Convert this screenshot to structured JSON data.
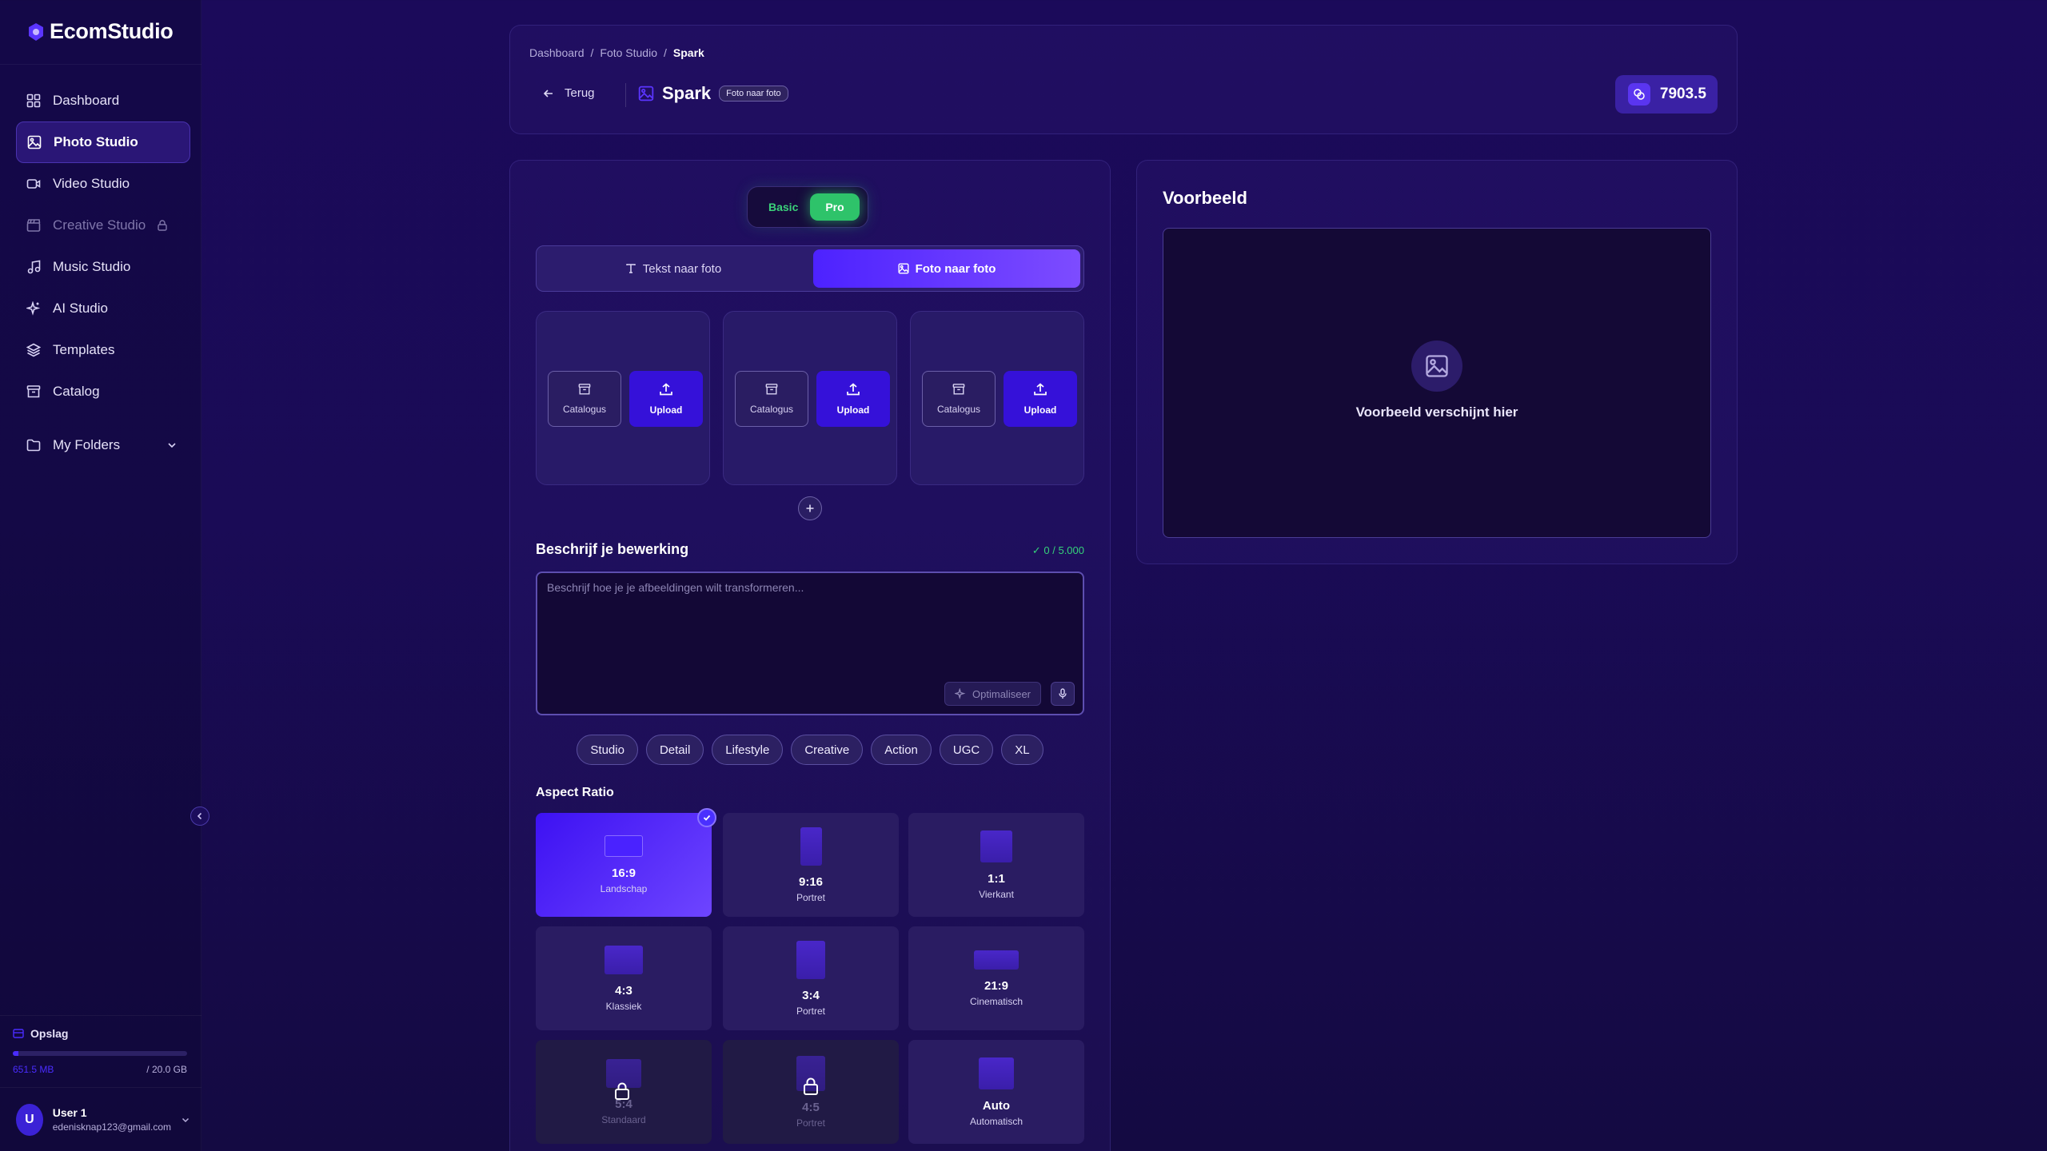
{
  "app": {
    "name": "EcomStudio"
  },
  "sidebar": {
    "items": [
      {
        "label": "Dashboard",
        "icon": "grid-icon"
      },
      {
        "label": "Photo Studio",
        "icon": "image-icon",
        "active": true
      },
      {
        "label": "Video Studio",
        "icon": "video-icon"
      },
      {
        "label": "Creative Studio",
        "icon": "clapperboard-icon",
        "locked": true
      },
      {
        "label": "Music Studio",
        "icon": "music-icon"
      },
      {
        "label": "AI Studio",
        "icon": "sparkles-icon"
      },
      {
        "label": "Templates",
        "icon": "layers-icon"
      },
      {
        "label": "Catalog",
        "icon": "archive-icon"
      }
    ],
    "folders_label": "My Folders",
    "storage": {
      "title": "Opslag",
      "used": "651.5 MB",
      "total": "/ 20.0 GB",
      "fraction": 0.032
    },
    "user": {
      "initial": "U",
      "name": "User 1",
      "email": "edenisknap123@gmail.com"
    }
  },
  "header": {
    "breadcrumb": [
      "Dashboard",
      "Foto Studio",
      "Spark"
    ],
    "back_label": "Terug",
    "title": "Spark",
    "badge": "Foto naar foto",
    "credits": "7903.5"
  },
  "editor": {
    "toggle": {
      "basic": "Basic",
      "pro": "Pro"
    },
    "modes": [
      "Tekst naar foto",
      "Foto naar foto"
    ],
    "slots": [
      {
        "catalog": "Catalogus",
        "upload": "Upload"
      },
      {
        "catalog": "Catalogus",
        "upload": "Upload"
      },
      {
        "catalog": "Catalogus",
        "upload": "Upload"
      }
    ],
    "describe_title": "Beschrijf je bewerking",
    "char_count": "✓ 0 / 5.000",
    "prompt_placeholder": "Beschrijf hoe je je afbeeldingen wilt transformeren...",
    "optimize_label": "Optimaliseer",
    "chips": [
      "Studio",
      "Detail",
      "Lifestyle",
      "Creative",
      "Action",
      "UGC",
      "XL"
    ],
    "aspect_title": "Aspect Ratio",
    "ratios": [
      {
        "value": "16:9",
        "label": "Landschap",
        "selected": true
      },
      {
        "value": "9:16",
        "label": "Portret"
      },
      {
        "value": "1:1",
        "label": "Vierkant"
      },
      {
        "value": "4:3",
        "label": "Klassiek"
      },
      {
        "value": "3:4",
        "label": "Portret"
      },
      {
        "value": "21:9",
        "label": "Cinematisch"
      },
      {
        "value": "5:4",
        "label": "Standaard",
        "locked": true
      },
      {
        "value": "4:5",
        "label": "Portret",
        "locked": true
      },
      {
        "value": "Auto",
        "label": "Automatisch"
      }
    ]
  },
  "preview": {
    "title": "Voorbeeld",
    "empty_text": "Voorbeeld verschijnt hier"
  }
}
